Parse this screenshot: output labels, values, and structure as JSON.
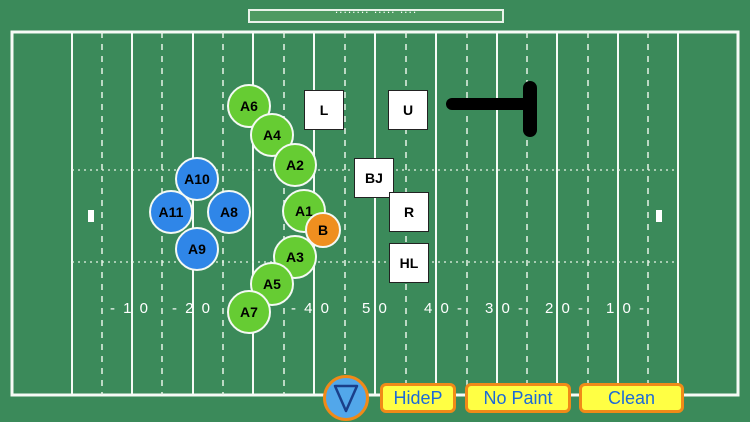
{
  "header": {
    "score_text": "........ ..... ...."
  },
  "players": {
    "a6": "A6",
    "a4": "A4",
    "a2": "A2",
    "a1": "A1",
    "a3": "A3",
    "a5": "A5",
    "a7": "A7",
    "a10": "A10",
    "a11": "A11",
    "a8": "A8",
    "a9": "A9",
    "b": "B"
  },
  "officials": {
    "l": "L",
    "u": "U",
    "bj": "BJ",
    "r": "R",
    "hl": "HL"
  },
  "yard_numbers": [
    "- 1 0",
    "- 2 0",
    "- 4 0",
    "5 0",
    "4 0 -",
    "3 0 -",
    "2 0 -",
    "1 0 -"
  ],
  "toolbar": {
    "hidep": "HideP",
    "no_paint": "No Paint",
    "clean": "Clean"
  },
  "colors": {
    "field": "#3b8a5a",
    "offense": "#66cc33",
    "defense": "#2f86e8",
    "ball": "#ef8f1f",
    "button": "#ffff44",
    "button_border": "#f08a18",
    "button_text": "#1c6ad8"
  }
}
